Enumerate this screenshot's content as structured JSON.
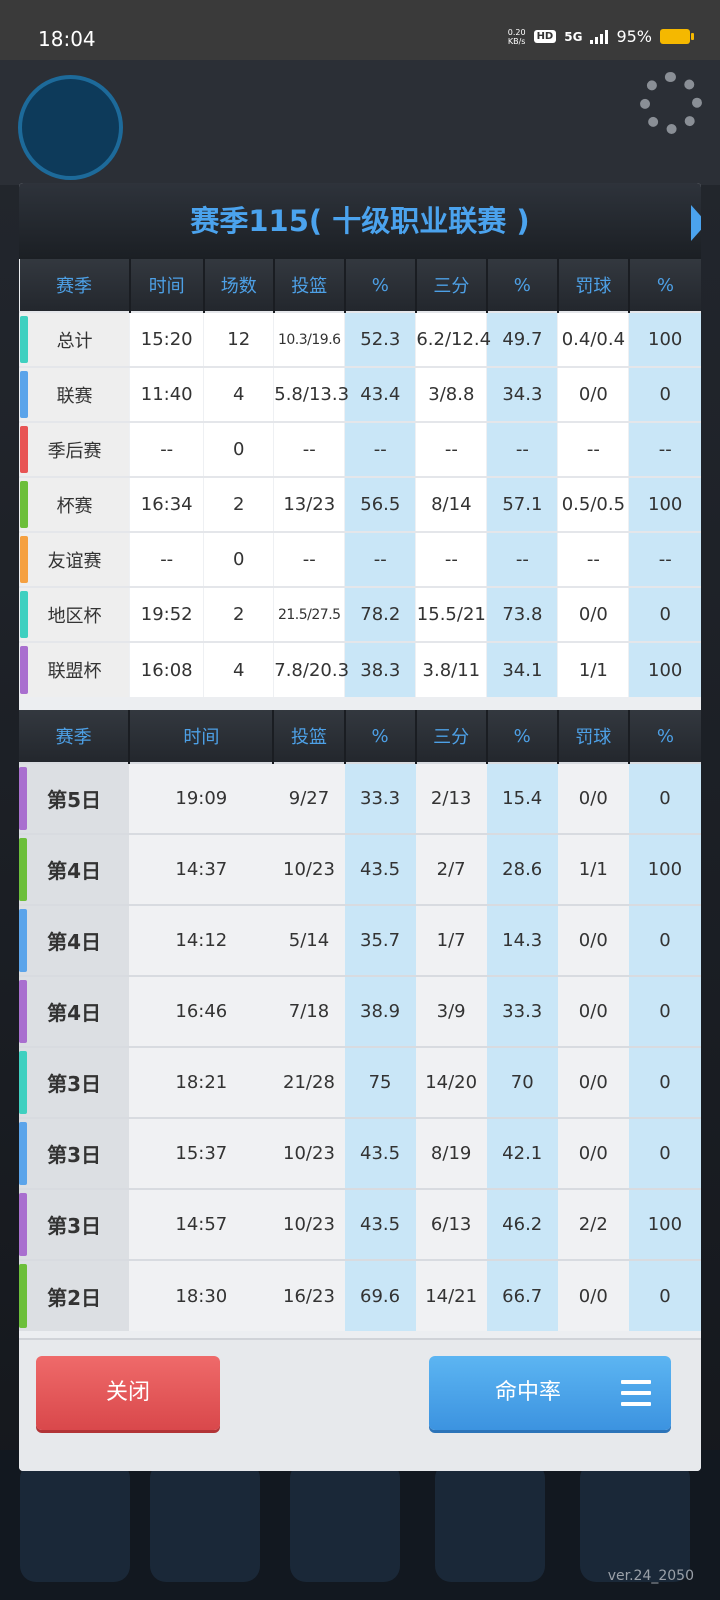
{
  "status_bar": {
    "time": "18:04",
    "net_speed_top": "0.20",
    "net_speed_unit": "KB/s",
    "hd": "HD",
    "network": "5G",
    "battery": "95%"
  },
  "version": "ver.24_2050",
  "dialog": {
    "title": "赛季115( 十级职业联赛 )",
    "summary_headers": [
      "赛季",
      "时间",
      "场数",
      "投篮",
      "%",
      "三分",
      "%",
      "罚球",
      "%"
    ],
    "summary_rows": [
      {
        "color": "#3fd0c0",
        "cells": [
          "总计",
          "15:20",
          "12",
          "10.3/19.6",
          "52.3",
          "6.2/12.4",
          "49.7",
          "0.4/0.4",
          "100"
        ]
      },
      {
        "color": "#5ba4ea",
        "cells": [
          "联赛",
          "11:40",
          "4",
          "5.8/13.3",
          "43.4",
          "3/8.8",
          "34.3",
          "0/0",
          "0"
        ]
      },
      {
        "color": "#e85454",
        "cells": [
          "季后赛",
          "--",
          "0",
          "--",
          "--",
          "--",
          "--",
          "--",
          "--"
        ]
      },
      {
        "color": "#6cbf3a",
        "cells": [
          "杯赛",
          "16:34",
          "2",
          "13/23",
          "56.5",
          "8/14",
          "57.1",
          "0.5/0.5",
          "100"
        ]
      },
      {
        "color": "#f5a040",
        "cells": [
          "友谊赛",
          "--",
          "0",
          "--",
          "--",
          "--",
          "--",
          "--",
          "--"
        ]
      },
      {
        "color": "#3fd0c0",
        "cells": [
          "地区杯",
          "19:52",
          "2",
          "21.5/27.5",
          "78.2",
          "15.5/21",
          "73.8",
          "0/0",
          "0"
        ]
      },
      {
        "color": "#a96fcf",
        "cells": [
          "联盟杯",
          "16:08",
          "4",
          "7.8/20.3",
          "38.3",
          "3.8/11",
          "34.1",
          "1/1",
          "100"
        ]
      }
    ],
    "game_headers": [
      "赛季",
      "时间",
      "投篮",
      "%",
      "三分",
      "%",
      "罚球",
      "%"
    ],
    "game_rows": [
      {
        "color": "#a96fcf",
        "cells": [
          "第5日",
          "19:09",
          "9/27",
          "33.3",
          "2/13",
          "15.4",
          "0/0",
          "0"
        ]
      },
      {
        "color": "#6cbf3a",
        "cells": [
          "第4日",
          "14:37",
          "10/23",
          "43.5",
          "2/7",
          "28.6",
          "1/1",
          "100"
        ]
      },
      {
        "color": "#5ba4ea",
        "cells": [
          "第4日",
          "14:12",
          "5/14",
          "35.7",
          "1/7",
          "14.3",
          "0/0",
          "0"
        ]
      },
      {
        "color": "#a96fcf",
        "cells": [
          "第4日",
          "16:46",
          "7/18",
          "38.9",
          "3/9",
          "33.3",
          "0/0",
          "0"
        ]
      },
      {
        "color": "#3fd0c0",
        "cells": [
          "第3日",
          "18:21",
          "21/28",
          "75",
          "14/20",
          "70",
          "0/0",
          "0"
        ]
      },
      {
        "color": "#5ba4ea",
        "cells": [
          "第3日",
          "15:37",
          "10/23",
          "43.5",
          "8/19",
          "42.1",
          "0/0",
          "0"
        ]
      },
      {
        "color": "#a96fcf",
        "cells": [
          "第3日",
          "14:57",
          "10/23",
          "43.5",
          "6/13",
          "46.2",
          "2/2",
          "100"
        ]
      },
      {
        "color": "#6cbf3a",
        "cells": [
          "第2日",
          "18:30",
          "16/23",
          "69.6",
          "14/21",
          "66.7",
          "0/0",
          "0"
        ]
      }
    ],
    "close_label": "关闭",
    "rate_label": "命中率"
  }
}
